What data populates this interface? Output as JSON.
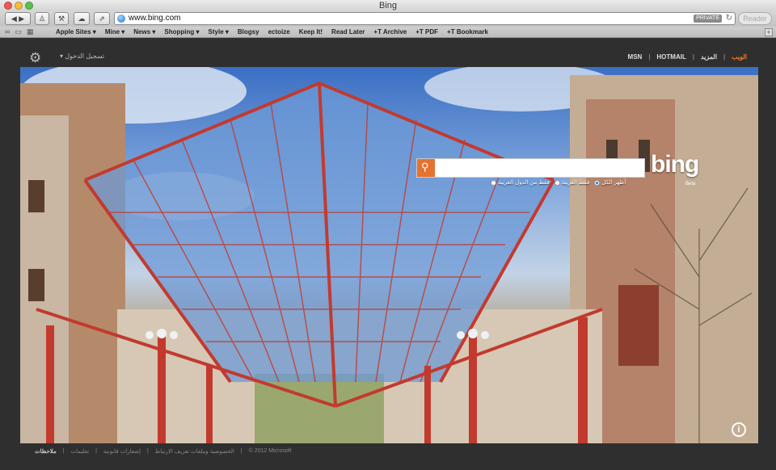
{
  "window": {
    "title": "Bing"
  },
  "toolbar": {
    "url": "www.bing.com",
    "private_label": "PRIVATE",
    "reader_label": "Reader"
  },
  "bookmarks": [
    "Apple Sites ▾",
    "Mine ▾",
    "News ▾",
    "Shopping ▾",
    "Style ▾",
    "Blogsy",
    "ectoize",
    "Keep It!",
    "Read Later",
    "+T Archive",
    "+T PDF",
    "+T Bookmark"
  ],
  "header": {
    "login": "تسجيل الدخول",
    "nav": {
      "web": "الويب",
      "more": "المزيد",
      "hotmail": "HOTMAIL",
      "msn": "MSN"
    }
  },
  "search": {
    "logo": "bing",
    "beta": "Beta",
    "options": [
      "أظهر الكل",
      "فقط العربية",
      "فقط من الدول العربية"
    ]
  },
  "footer": {
    "feedback": "ملاحظات",
    "help": "تعليمات",
    "legal": "إشعارات قانونية",
    "privacy": "الخصوصية وملفات تعريف الارتباط",
    "copyright": "© 2012 Microsoft"
  },
  "colors": {
    "accent": "#f27c2b",
    "search_button": "#e6722f",
    "page_bg": "#2f2f2f"
  }
}
